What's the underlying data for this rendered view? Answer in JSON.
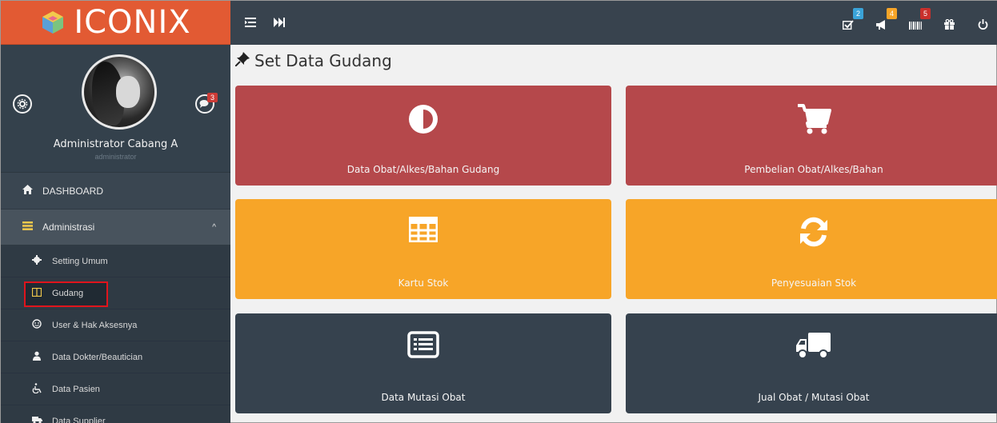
{
  "app": {
    "logo_text": "ICONIX",
    "colors": {
      "brand": "#e25a33",
      "sidebar": "#3a4651",
      "topbar": "#38434e",
      "red": "#b5484b",
      "orange": "#f7a528",
      "dark": "#36424e",
      "highlight": "#e0141c"
    }
  },
  "profile": {
    "name": "Administrator Cabang A",
    "role": "administrator",
    "messages_count": "3"
  },
  "sidebar": {
    "dashboard": "DASHBOARD",
    "admin": "Administrasi",
    "items": [
      {
        "label": "Setting Umum",
        "icon": "gear-icon"
      },
      {
        "label": "Gudang",
        "icon": "columns-icon"
      },
      {
        "label": "User & Hak Aksesnya",
        "icon": "smile-icon"
      },
      {
        "label": "Data Dokter/Beautician",
        "icon": "user-md-icon"
      },
      {
        "label": "Data Pasien",
        "icon": "wheelchair-icon"
      },
      {
        "label": "Data Supplier",
        "icon": "truck-icon"
      }
    ]
  },
  "topbar": {
    "badges": {
      "tasks": "2",
      "announcements": "4",
      "barcode": "5"
    }
  },
  "page": {
    "title": "Set Data Gudang",
    "tiles": [
      {
        "label": "Data Obat/Alkes/Bahan Gudang",
        "icon": "adjust-icon"
      },
      {
        "label": "Pembelian Obat/Alkes/Bahan",
        "icon": "cart-icon"
      },
      {
        "label": "Kartu Stok",
        "icon": "table-icon"
      },
      {
        "label": "Penyesuaian Stok",
        "icon": "refresh-icon"
      },
      {
        "label": "Data Mutasi Obat",
        "icon": "list-alt-icon"
      },
      {
        "label": "Jual Obat / Mutasi Obat",
        "icon": "truck-icon"
      }
    ]
  }
}
